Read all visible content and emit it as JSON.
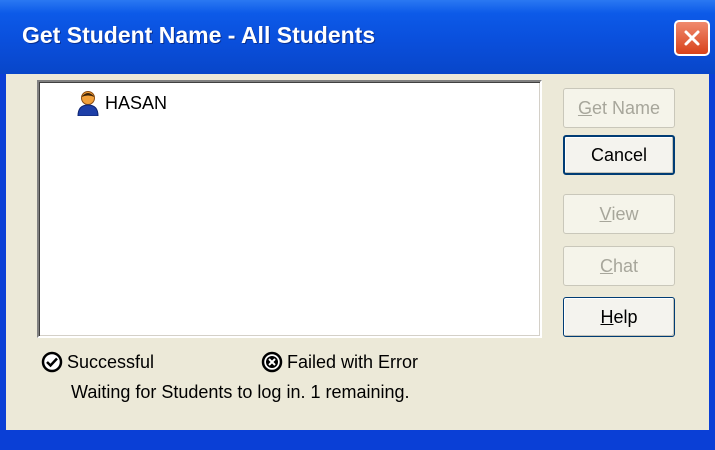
{
  "window": {
    "title": "Get Student Name - All Students"
  },
  "list": {
    "items": [
      {
        "name": "HASAN",
        "icon": "student-user-icon"
      }
    ]
  },
  "buttons": {
    "get_name": {
      "accel": "G",
      "rest": "et Name",
      "enabled": false
    },
    "cancel": {
      "label": "Cancel",
      "enabled": true
    },
    "view": {
      "accel": "V",
      "rest": "iew",
      "enabled": false
    },
    "chat": {
      "accel": "C",
      "rest": "hat",
      "enabled": false
    },
    "help": {
      "accel": "H",
      "rest": "elp",
      "enabled": true
    }
  },
  "legend": {
    "success_label": "Successful",
    "success_icon": "check-circle-icon",
    "error_label": "Failed with Error",
    "error_icon": "x-circle-icon"
  },
  "status": "Waiting for Students to log in. 1 remaining.",
  "colors": {
    "titlebar": "#0a4fdc",
    "close": "#d8421b",
    "dialog_bg": "#ece9d8"
  }
}
